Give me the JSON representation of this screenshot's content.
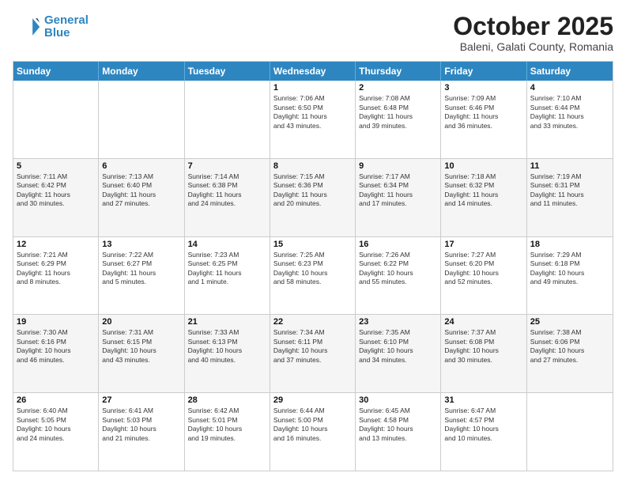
{
  "header": {
    "logo_line1": "General",
    "logo_line2": "Blue",
    "month": "October 2025",
    "location": "Baleni, Galati County, Romania"
  },
  "days_of_week": [
    "Sunday",
    "Monday",
    "Tuesday",
    "Wednesday",
    "Thursday",
    "Friday",
    "Saturday"
  ],
  "weeks": [
    [
      {
        "day": "",
        "text": ""
      },
      {
        "day": "",
        "text": ""
      },
      {
        "day": "",
        "text": ""
      },
      {
        "day": "1",
        "text": "Sunrise: 7:06 AM\nSunset: 6:50 PM\nDaylight: 11 hours\nand 43 minutes."
      },
      {
        "day": "2",
        "text": "Sunrise: 7:08 AM\nSunset: 6:48 PM\nDaylight: 11 hours\nand 39 minutes."
      },
      {
        "day": "3",
        "text": "Sunrise: 7:09 AM\nSunset: 6:46 PM\nDaylight: 11 hours\nand 36 minutes."
      },
      {
        "day": "4",
        "text": "Sunrise: 7:10 AM\nSunset: 6:44 PM\nDaylight: 11 hours\nand 33 minutes."
      }
    ],
    [
      {
        "day": "5",
        "text": "Sunrise: 7:11 AM\nSunset: 6:42 PM\nDaylight: 11 hours\nand 30 minutes."
      },
      {
        "day": "6",
        "text": "Sunrise: 7:13 AM\nSunset: 6:40 PM\nDaylight: 11 hours\nand 27 minutes."
      },
      {
        "day": "7",
        "text": "Sunrise: 7:14 AM\nSunset: 6:38 PM\nDaylight: 11 hours\nand 24 minutes."
      },
      {
        "day": "8",
        "text": "Sunrise: 7:15 AM\nSunset: 6:36 PM\nDaylight: 11 hours\nand 20 minutes."
      },
      {
        "day": "9",
        "text": "Sunrise: 7:17 AM\nSunset: 6:34 PM\nDaylight: 11 hours\nand 17 minutes."
      },
      {
        "day": "10",
        "text": "Sunrise: 7:18 AM\nSunset: 6:32 PM\nDaylight: 11 hours\nand 14 minutes."
      },
      {
        "day": "11",
        "text": "Sunrise: 7:19 AM\nSunset: 6:31 PM\nDaylight: 11 hours\nand 11 minutes."
      }
    ],
    [
      {
        "day": "12",
        "text": "Sunrise: 7:21 AM\nSunset: 6:29 PM\nDaylight: 11 hours\nand 8 minutes."
      },
      {
        "day": "13",
        "text": "Sunrise: 7:22 AM\nSunset: 6:27 PM\nDaylight: 11 hours\nand 5 minutes."
      },
      {
        "day": "14",
        "text": "Sunrise: 7:23 AM\nSunset: 6:25 PM\nDaylight: 11 hours\nand 1 minute."
      },
      {
        "day": "15",
        "text": "Sunrise: 7:25 AM\nSunset: 6:23 PM\nDaylight: 10 hours\nand 58 minutes."
      },
      {
        "day": "16",
        "text": "Sunrise: 7:26 AM\nSunset: 6:22 PM\nDaylight: 10 hours\nand 55 minutes."
      },
      {
        "day": "17",
        "text": "Sunrise: 7:27 AM\nSunset: 6:20 PM\nDaylight: 10 hours\nand 52 minutes."
      },
      {
        "day": "18",
        "text": "Sunrise: 7:29 AM\nSunset: 6:18 PM\nDaylight: 10 hours\nand 49 minutes."
      }
    ],
    [
      {
        "day": "19",
        "text": "Sunrise: 7:30 AM\nSunset: 6:16 PM\nDaylight: 10 hours\nand 46 minutes."
      },
      {
        "day": "20",
        "text": "Sunrise: 7:31 AM\nSunset: 6:15 PM\nDaylight: 10 hours\nand 43 minutes."
      },
      {
        "day": "21",
        "text": "Sunrise: 7:33 AM\nSunset: 6:13 PM\nDaylight: 10 hours\nand 40 minutes."
      },
      {
        "day": "22",
        "text": "Sunrise: 7:34 AM\nSunset: 6:11 PM\nDaylight: 10 hours\nand 37 minutes."
      },
      {
        "day": "23",
        "text": "Sunrise: 7:35 AM\nSunset: 6:10 PM\nDaylight: 10 hours\nand 34 minutes."
      },
      {
        "day": "24",
        "text": "Sunrise: 7:37 AM\nSunset: 6:08 PM\nDaylight: 10 hours\nand 30 minutes."
      },
      {
        "day": "25",
        "text": "Sunrise: 7:38 AM\nSunset: 6:06 PM\nDaylight: 10 hours\nand 27 minutes."
      }
    ],
    [
      {
        "day": "26",
        "text": "Sunrise: 6:40 AM\nSunset: 5:05 PM\nDaylight: 10 hours\nand 24 minutes."
      },
      {
        "day": "27",
        "text": "Sunrise: 6:41 AM\nSunset: 5:03 PM\nDaylight: 10 hours\nand 21 minutes."
      },
      {
        "day": "28",
        "text": "Sunrise: 6:42 AM\nSunset: 5:01 PM\nDaylight: 10 hours\nand 19 minutes."
      },
      {
        "day": "29",
        "text": "Sunrise: 6:44 AM\nSunset: 5:00 PM\nDaylight: 10 hours\nand 16 minutes."
      },
      {
        "day": "30",
        "text": "Sunrise: 6:45 AM\nSunset: 4:58 PM\nDaylight: 10 hours\nand 13 minutes."
      },
      {
        "day": "31",
        "text": "Sunrise: 6:47 AM\nSunset: 4:57 PM\nDaylight: 10 hours\nand 10 minutes."
      },
      {
        "day": "",
        "text": ""
      }
    ]
  ]
}
